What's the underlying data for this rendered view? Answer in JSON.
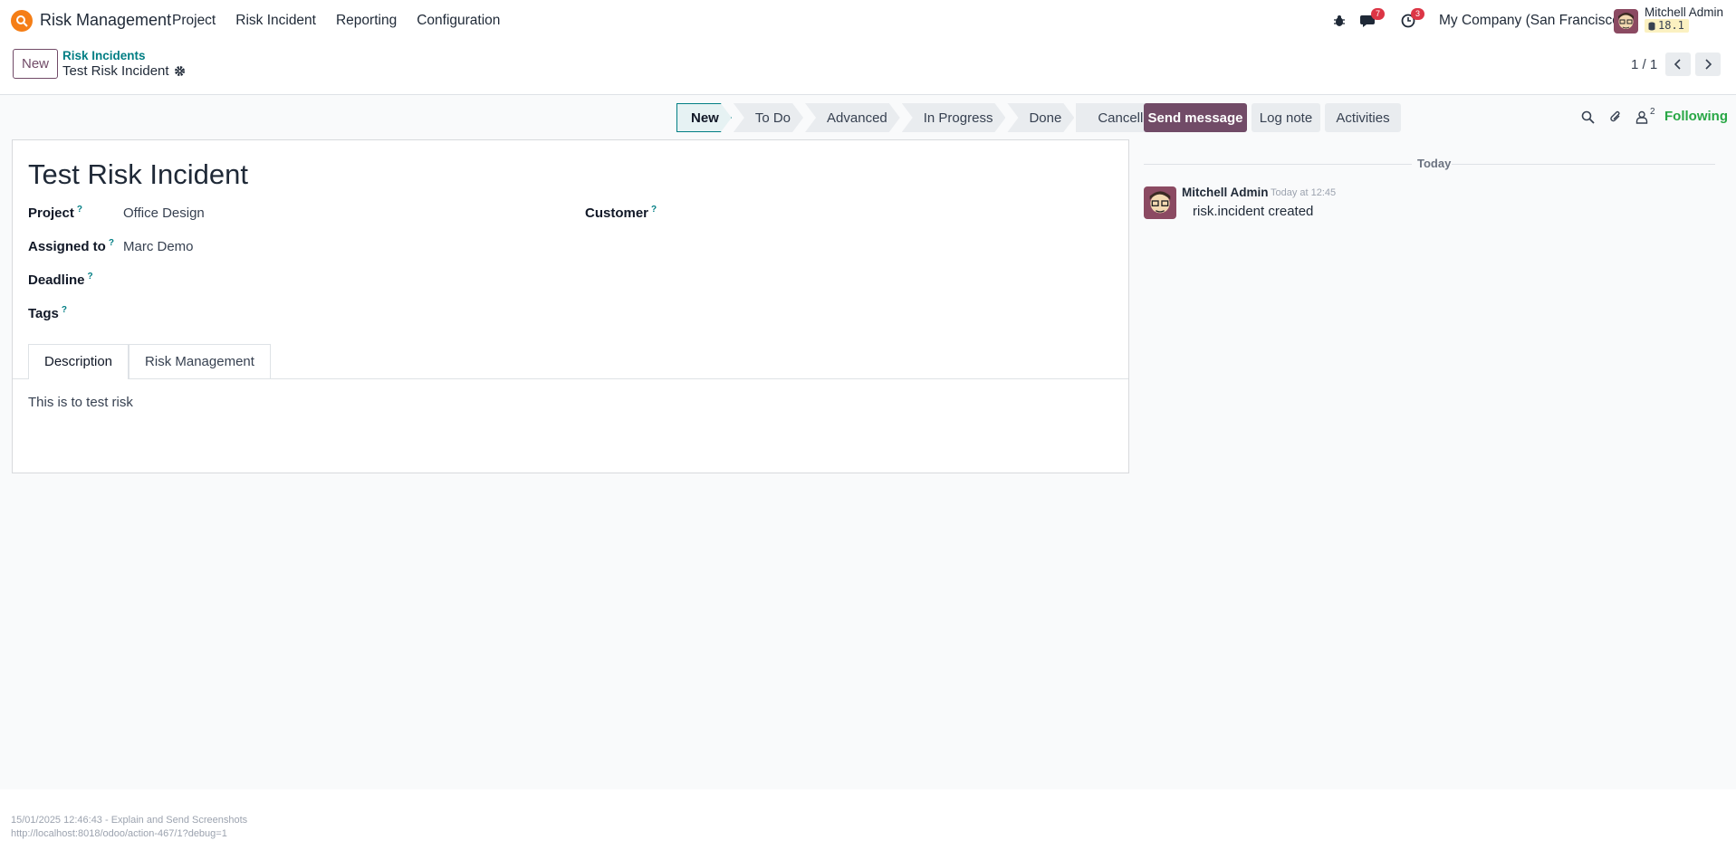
{
  "navbar": {
    "app_name": "Risk Management",
    "menu": [
      "Project",
      "Risk Incident",
      "Reporting",
      "Configuration"
    ],
    "discuss_badge": "7",
    "activity_badge": "3",
    "company": "My Company (San Francisco)",
    "user_name": "Mitchell Admin",
    "db_version": "18.1"
  },
  "control_panel": {
    "new_label": "New",
    "breadcrumb_parent": "Risk Incidents",
    "breadcrumb_current": "Test Risk Incident",
    "pager_value": "1 / 1"
  },
  "statusbar": {
    "stages": [
      "New",
      "To Do",
      "Advanced",
      "In Progress",
      "Done",
      "Cancelled"
    ],
    "active_stage": "New"
  },
  "form": {
    "title": "Test Risk Incident",
    "fields": {
      "project_label": "Project",
      "project_value": "Office Design",
      "assigned_label": "Assigned to",
      "assigned_value": "Marc Demo",
      "deadline_label": "Deadline",
      "tags_label": "Tags",
      "customer_label": "Customer",
      "help_mark": "?"
    },
    "tabs": [
      "Description",
      "Risk Management"
    ],
    "description": "This is to test risk"
  },
  "chatter": {
    "send_message": "Send message",
    "log_note": "Log note",
    "activities": "Activities",
    "follower_count": "2",
    "following": "Following",
    "date_separator": "Today",
    "message": {
      "author": "Mitchell Admin",
      "date": "Today at 12:45",
      "body": "risk.incident created"
    }
  },
  "footer": {
    "line1": "15/01/2025 12:46:43 - Explain and Send Screenshots",
    "line2": "http://localhost:8018/odoo/action-467/1?debug=1"
  },
  "colors": {
    "brand": "#714b67",
    "link": "#017e84",
    "following": "#28a745",
    "badge": "#dc3545",
    "logo": "#f57e16"
  }
}
